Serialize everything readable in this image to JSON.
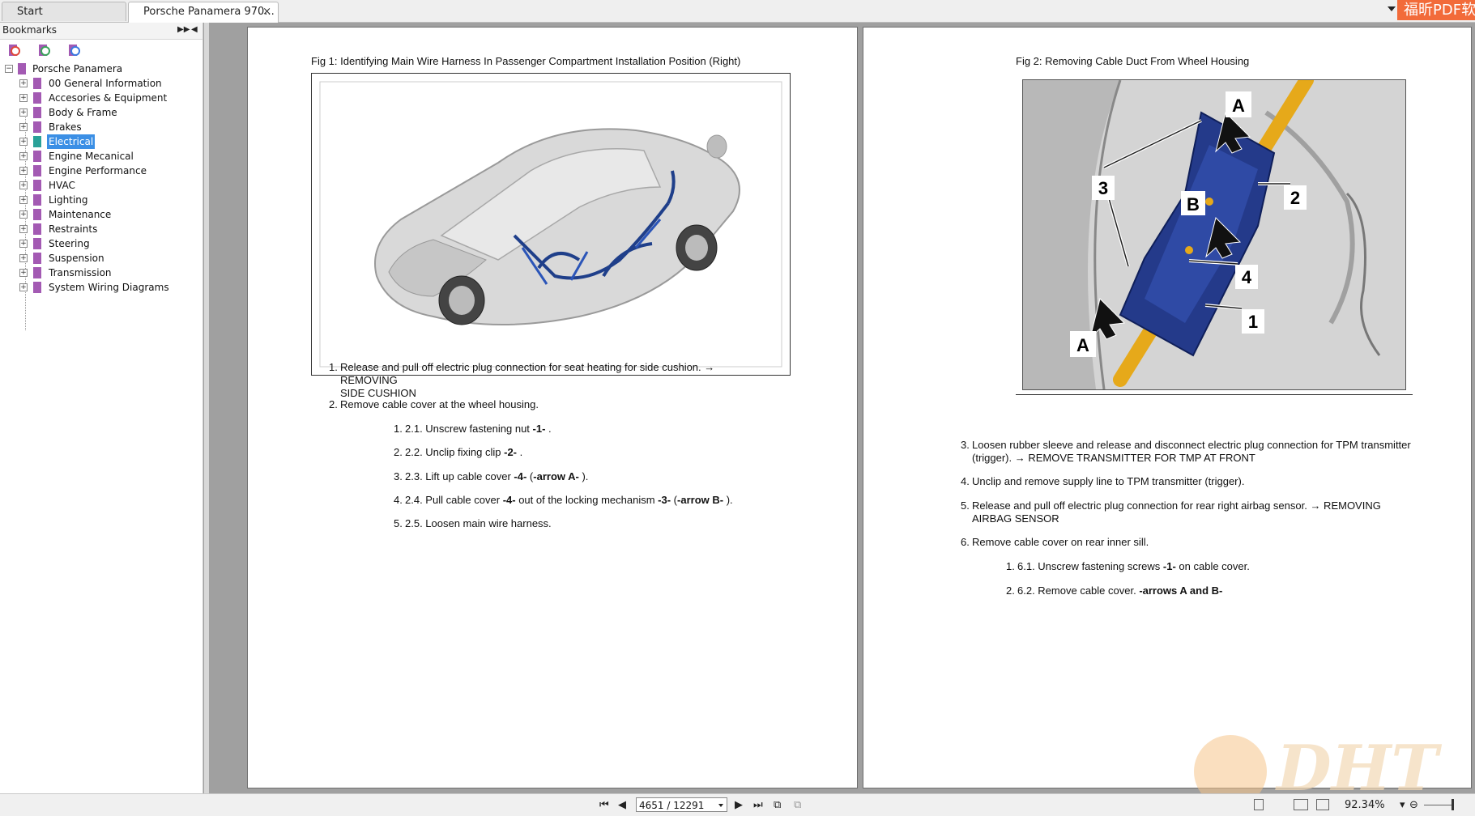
{
  "tabs": [
    {
      "label": "Start"
    },
    {
      "label": "Porsche Panamera 970...",
      "close": "×"
    }
  ],
  "brand_badge": "福昕PDF软",
  "bookmarks_panel": {
    "title": "Bookmarks",
    "root": "Porsche Panamera",
    "items": [
      {
        "label": "00 General Information"
      },
      {
        "label": "Accesories & Equipment"
      },
      {
        "label": "Body & Frame"
      },
      {
        "label": "Brakes"
      },
      {
        "label": "Electrical",
        "selected": true
      },
      {
        "label": "Engine Mecanical"
      },
      {
        "label": "Engine Performance"
      },
      {
        "label": "HVAC"
      },
      {
        "label": "Lighting"
      },
      {
        "label": "Maintenance"
      },
      {
        "label": "Restraints"
      },
      {
        "label": "Steering"
      },
      {
        "label": "Suspension"
      },
      {
        "label": "Transmission"
      },
      {
        "label": "System Wiring Diagrams"
      }
    ]
  },
  "page1": {
    "caption": "Fig 1: Identifying Main Wire Harness In Passenger Compartment Installation Position (Right)",
    "steps": [
      {
        "n": "1.",
        "text": "Release and pull off electric plug connection for seat heating for side cushion. → REMOVING",
        "text2": "SIDE CUSHION"
      },
      {
        "n": "2.",
        "text": "Remove cable cover at the wheel housing."
      }
    ],
    "substeps": [
      {
        "n": "1.",
        "pre": "2.1. Unscrew fastening nut ",
        "bold": "-1-",
        "post": " ."
      },
      {
        "n": "2.",
        "pre": "2.2. Unclip fixing clip ",
        "bold": "-2-",
        "post": " ."
      },
      {
        "n": "3.",
        "pre": "2.3. Lift up cable cover ",
        "bold": "-4-",
        "mid": " (",
        "bold2": "-arrow A-",
        "post": " )."
      },
      {
        "n": "4.",
        "pre": "2.4. Pull cable cover ",
        "bold": "-4-",
        "mid": " out of the locking mechanism ",
        "bold2": "-3-",
        "mid2": " (",
        "bold3": "-arrow B-",
        "post": " )."
      },
      {
        "n": "5.",
        "pre": "2.5. Loosen main wire harness."
      }
    ]
  },
  "page2": {
    "caption": "Fig 2: Removing Cable Duct From Wheel Housing",
    "labels": {
      "a_top": "A",
      "a_bottom": "A",
      "b": "B",
      "n1": "1",
      "n2": "2",
      "n3": "3",
      "n4": "4"
    },
    "steps": [
      {
        "n": "3.",
        "text": "Loosen rubber sleeve and release and disconnect electric plug connection for TPM transmitter",
        "text2": "(trigger). → REMOVE TRANSMITTER FOR TMP AT FRONT"
      },
      {
        "n": "4.",
        "text": "Unclip and remove supply line to TPM transmitter (trigger)."
      },
      {
        "n": "5.",
        "text": "Release and pull off electric plug connection for rear right airbag sensor. → REMOVING",
        "text2": "AIRBAG SENSOR"
      },
      {
        "n": "6.",
        "text": "Remove cable cover on rear inner sill."
      }
    ],
    "substeps": [
      {
        "n": "1.",
        "pre": "6.1. Unscrew fastening screws ",
        "bold": "-1-",
        "post": " on cable cover."
      },
      {
        "n": "2.",
        "pre": "6.2. Remove cable cover. ",
        "bold": "-arrows A and B-"
      }
    ]
  },
  "bottombar": {
    "page_indicator": "4651 / 12291",
    "zoom": "92.34%"
  },
  "watermark": "DHT",
  "colors": {
    "accent": "#3b8fe5",
    "bookmark": "#a35ab3",
    "brand": "#f26b3a"
  }
}
